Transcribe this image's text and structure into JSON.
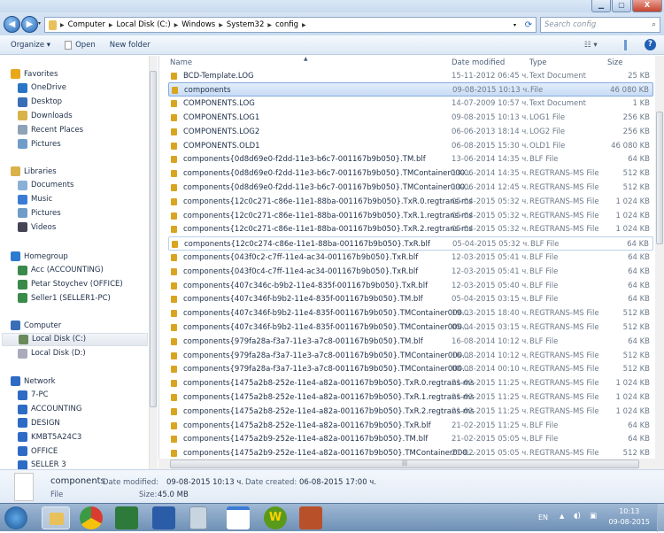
{
  "window": {
    "controls": {
      "minimize": "▁",
      "maximize": "▢",
      "close": "X"
    }
  },
  "address": {
    "crumbs": [
      "Computer",
      "Local Disk (C:)",
      "Windows",
      "System32",
      "config"
    ],
    "search_placeholder": "Search config",
    "back": "◀",
    "forward": "▶"
  },
  "toolbar": {
    "organize": "Organize ▾",
    "open": "Open",
    "new_folder": "New folder",
    "help": "?"
  },
  "nav": {
    "favorites": {
      "label": "Favorites",
      "items": [
        "OneDrive",
        "Desktop",
        "Downloads",
        "Recent Places",
        "Pictures"
      ]
    },
    "libraries": {
      "label": "Libraries",
      "items": [
        "Documents",
        "Music",
        "Pictures",
        "Videos"
      ]
    },
    "homegroup": {
      "label": "Homegroup",
      "items": [
        "Acc (ACCOUNTING)",
        "Petar Stoychev (OFFICE)",
        "Seller1 (SELLER1-PC)"
      ]
    },
    "computer": {
      "label": "Computer",
      "items": [
        "Local Disk (C:)",
        "Local Disk (D:)"
      ]
    },
    "network": {
      "label": "Network",
      "items": [
        "7-PC",
        "ACCOUNTING",
        "DESIGN",
        "KMBT5A24C3",
        "OFFICE",
        "SELLER 3",
        "SELLER1-PC"
      ]
    }
  },
  "columns": {
    "name": "Name",
    "date": "Date modified",
    "type": "Type",
    "size": "Size"
  },
  "files": [
    {
      "name": "BCD-Template.LOG",
      "date": "15-11-2012 06:45 ч.",
      "type": "Text Document",
      "size": "25 KB"
    },
    {
      "name": "components",
      "date": "09-08-2015 10:13 ч.",
      "type": "File",
      "size": "46 080 KB"
    },
    {
      "name": "COMPONENTS.LOG",
      "date": "14-07-2009 10:57 ч.",
      "type": "Text Document",
      "size": "1 KB"
    },
    {
      "name": "COMPONENTS.LOG1",
      "date": "09-08-2015 10:13 ч.",
      "type": "LOG1 File",
      "size": "256 KB"
    },
    {
      "name": "COMPONENTS.LOG2",
      "date": "06-06-2013 18:14 ч.",
      "type": "LOG2 File",
      "size": "256 KB"
    },
    {
      "name": "COMPONENTS.OLD1",
      "date": "06-08-2015 15:30 ч.",
      "type": "OLD1 File",
      "size": "46 080 KB"
    },
    {
      "name": "components{0d8d69e0-f2dd-11e3-b6c7-001167b9b050}.TM.blf",
      "date": "13-06-2014 14:35 ч.",
      "type": "BLF File",
      "size": "64 KB"
    },
    {
      "name": "components{0d8d69e0-f2dd-11e3-b6c7-001167b9b050}.TMContainer000...",
      "date": "13-06-2014 14:35 ч.",
      "type": "REGTRANS-MS File",
      "size": "512 KB"
    },
    {
      "name": "components{0d8d69e0-f2dd-11e3-b6c7-001167b9b050}.TMContainer000...",
      "date": "13-06-2014 12:45 ч.",
      "type": "REGTRANS-MS File",
      "size": "512 KB"
    },
    {
      "name": "components{12c0c271-c86e-11e1-88ba-001167b9b050}.TxR.0.regtrans-ms",
      "date": "05-04-2015 05:32 ч.",
      "type": "REGTRANS-MS File",
      "size": "1 024 KB"
    },
    {
      "name": "components{12c0c271-c86e-11e1-88ba-001167b9b050}.TxR.1.regtrans-ms",
      "date": "05-04-2015 05:32 ч.",
      "type": "REGTRANS-MS File",
      "size": "1 024 KB"
    },
    {
      "name": "components{12c0c271-c86e-11e1-88ba-001167b9b050}.TxR.2.regtrans-ms",
      "date": "05-04-2015 05:32 ч.",
      "type": "REGTRANS-MS File",
      "size": "1 024 KB"
    },
    {
      "name": "components{12c0c274-c86e-11e1-88ba-001167b9b050}.TxR.blf",
      "date": "05-04-2015 05:32 ч.",
      "type": "BLF File",
      "size": "64 KB"
    },
    {
      "name": "components{043f0c2-c7ff-11e4-ac34-001167b9b050}.TxR.blf",
      "date": "12-03-2015 05:41 ч.",
      "type": "BLF File",
      "size": "64 KB"
    },
    {
      "name": "components{043f0c4-c7ff-11e4-ac34-001167b9b050}.TxR.blf",
      "date": "12-03-2015 05:41 ч.",
      "type": "BLF File",
      "size": "64 KB"
    },
    {
      "name": "components{407c346c-b9b2-11e4-835f-001167b9b050}.TxR.blf",
      "date": "12-03-2015 05:40 ч.",
      "type": "BLF File",
      "size": "64 KB"
    },
    {
      "name": "components{407c346f-b9b2-11e4-835f-001167b9b050}.TM.blf",
      "date": "05-04-2015 03:15 ч.",
      "type": "BLF File",
      "size": "64 KB"
    },
    {
      "name": "components{407c346f-b9b2-11e4-835f-001167b9b050}.TMContainer000...",
      "date": "19-03-2015 18:40 ч.",
      "type": "REGTRANS-MS File",
      "size": "512 KB"
    },
    {
      "name": "components{407c346f-b9b2-11e4-835f-001167b9b050}.TMContainer000...",
      "date": "05-04-2015 03:15 ч.",
      "type": "REGTRANS-MS File",
      "size": "512 KB"
    },
    {
      "name": "components{979fa28a-f3a7-11e3-a7c8-001167b9b050}.TM.blf",
      "date": "16-08-2014 10:12 ч.",
      "type": "BLF File",
      "size": "64 KB"
    },
    {
      "name": "components{979fa28a-f3a7-11e3-a7c8-001167b9b050}.TMContainer000...",
      "date": "16-08-2014 10:12 ч.",
      "type": "REGTRANS-MS File",
      "size": "512 KB"
    },
    {
      "name": "components{979fa28a-f3a7-11e3-a7c8-001167b9b050}.TMContainer000...",
      "date": "08-08-2014 00:10 ч.",
      "type": "REGTRANS-MS File",
      "size": "512 KB"
    },
    {
      "name": "components{1475a2b8-252e-11e4-a82a-001167b9b050}.TxR.0.regtrans-ms",
      "date": "21-02-2015 11:25 ч.",
      "type": "REGTRANS-MS File",
      "size": "1 024 KB"
    },
    {
      "name": "components{1475a2b8-252e-11e4-a82a-001167b9b050}.TxR.1.regtrans-ms",
      "date": "21-02-2015 11:25 ч.",
      "type": "REGTRANS-MS File",
      "size": "1 024 KB"
    },
    {
      "name": "components{1475a2b8-252e-11e4-a82a-001167b9b050}.TxR.2.regtrans-ms",
      "date": "21-02-2015 11:25 ч.",
      "type": "REGTRANS-MS File",
      "size": "1 024 KB"
    },
    {
      "name": "components{1475a2b8-252e-11e4-a82a-001167b9b050}.TxR.blf",
      "date": "21-02-2015 11:25 ч.",
      "type": "BLF File",
      "size": "64 KB"
    },
    {
      "name": "components{1475a2b9-252e-11e4-a82a-001167b9b050}.TM.blf",
      "date": "21-02-2015 05:05 ч.",
      "type": "BLF File",
      "size": "64 KB"
    },
    {
      "name": "components{1475a2b9-252e-11e4-a82a-001167b9b050}.TMContainer000...",
      "date": "21-02-2015 05:05 ч.",
      "type": "REGTRANS-MS File",
      "size": "512 KB"
    }
  ],
  "selected_index": 1,
  "hover_index": 12,
  "details": {
    "name": "components",
    "type": "File",
    "modified_label": "Date modified:",
    "modified": "09-08-2015 10:13 ч.",
    "created_label": "Date created:",
    "created": "06-08-2015 17:00 ч.",
    "size_label": "Size:",
    "size": "45.0 MB"
  },
  "taskbar": {
    "apps": [
      "windows-explorer",
      "chrome",
      "excel",
      "word",
      "calculator",
      "window",
      "w-app",
      "truck-app"
    ],
    "lang": "EN",
    "time": "10:13",
    "date": "09-08-2015"
  },
  "colors": {
    "selection": "#c8dcf5",
    "taskbar": "#7f9ec2",
    "folder_lock": "#d9a521"
  }
}
